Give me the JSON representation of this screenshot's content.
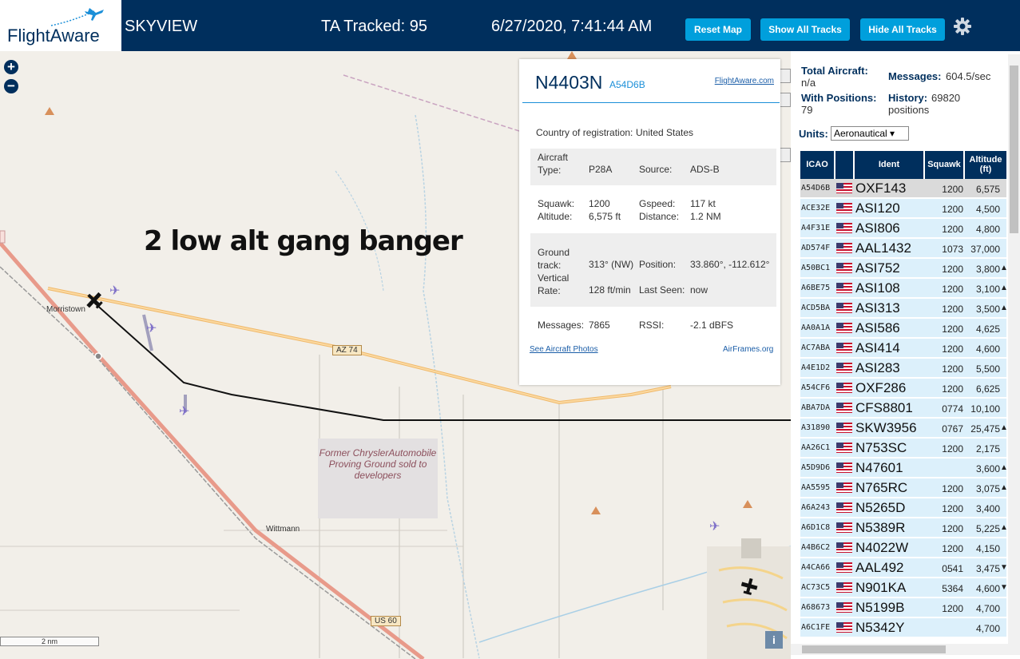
{
  "header": {
    "logo_text": "FlightAware",
    "app_name": "SKYVIEW",
    "tracked": "TA Tracked: 95",
    "datetime": "6/27/2020, 7:41:44 AM",
    "buttons": {
      "reset": "Reset Map",
      "show_all": "Show All Tracks",
      "hide_all": "Hide All Tracks"
    }
  },
  "map": {
    "zoom_in": "+",
    "zoom_out": "−",
    "annotation": "2 low alt gang banger",
    "labels": {
      "morristown": "Morristown",
      "wittmann": "Wittmann",
      "az74": "AZ 74",
      "us60": "US 60"
    },
    "proving_ground": "Former ChryslerAutomobile Proving Ground sold to developers",
    "scale": "2 nm",
    "info": "i"
  },
  "popup": {
    "ident": "N4403N",
    "hex": "A54D6B",
    "fa_link": "FlightAware.com",
    "country_label": "Country of registration:",
    "country": "United States",
    "aircraft_type_label": "Aircraft Type:",
    "aircraft_type": "P28A",
    "source_label": "Source:",
    "source": "ADS-B",
    "squawk_label": "Squawk:",
    "squawk": "1200",
    "gspeed_label": "Gspeed:",
    "gspeed": "117 kt",
    "altitude_label": "Altitude:",
    "altitude": "6,575 ft",
    "distance_label": "Distance:",
    "distance": "1.2 NM",
    "ground_track_label": "Ground track:",
    "ground_track": "313° (NW)",
    "position_label": "Position:",
    "position": "33.860°, -112.612°",
    "vrate_label": "Vertical Rate:",
    "vrate": "128 ft/min",
    "last_seen_label": "Last Seen:",
    "last_seen": "now",
    "messages_label": "Messages:",
    "messages": "7865",
    "rssi_label": "RSSI:",
    "rssi": "-2.1 dBFS",
    "photos_link": "See Aircraft Photos",
    "airframes_link": "AirFrames.org"
  },
  "sidebar": {
    "total_label": "Total Aircraft:",
    "total": "n/a",
    "messages_label": "Messages:",
    "messages": "604.5/sec",
    "with_pos_label": "With Positions:",
    "with_pos": "79",
    "history_label": "History:",
    "history": "69820 positions",
    "units_label": "Units:",
    "units_value": "Aeronautical ▾",
    "columns": {
      "icao": "ICAO",
      "ident": "Ident",
      "squawk": "Squawk",
      "altitude": "Altitude (ft)"
    },
    "rows": [
      {
        "icao": "A54D6B",
        "ident": "OXF143",
        "squawk": "1200",
        "alt": "6,575",
        "trend": ""
      },
      {
        "icao": "ACE32E",
        "ident": "ASI120",
        "squawk": "1200",
        "alt": "4,500",
        "trend": ""
      },
      {
        "icao": "A4F31E",
        "ident": "ASI806",
        "squawk": "1200",
        "alt": "4,800",
        "trend": ""
      },
      {
        "icao": "AD574F",
        "ident": "AAL1432",
        "squawk": "1073",
        "alt": "37,000",
        "trend": ""
      },
      {
        "icao": "A50BC1",
        "ident": "ASI752",
        "squawk": "1200",
        "alt": "3,800",
        "trend": "▲"
      },
      {
        "icao": "A6BE75",
        "ident": "ASI108",
        "squawk": "1200",
        "alt": "3,100",
        "trend": "▲"
      },
      {
        "icao": "ACD5BA",
        "ident": "ASI313",
        "squawk": "1200",
        "alt": "3,500",
        "trend": "▲"
      },
      {
        "icao": "AA0A1A",
        "ident": "ASI586",
        "squawk": "1200",
        "alt": "4,625",
        "trend": ""
      },
      {
        "icao": "AC7ABA",
        "ident": "ASI414",
        "squawk": "1200",
        "alt": "4,600",
        "trend": ""
      },
      {
        "icao": "A4E1D2",
        "ident": "ASI283",
        "squawk": "1200",
        "alt": "5,500",
        "trend": ""
      },
      {
        "icao": "A54CF6",
        "ident": "OXF286",
        "squawk": "1200",
        "alt": "6,625",
        "trend": ""
      },
      {
        "icao": "ABA7DA",
        "ident": "CFS8801",
        "squawk": "0774",
        "alt": "10,100",
        "trend": ""
      },
      {
        "icao": "A31890",
        "ident": "SKW3956",
        "squawk": "0767",
        "alt": "25,475",
        "trend": "▲"
      },
      {
        "icao": "AA26C1",
        "ident": "N753SC",
        "squawk": "1200",
        "alt": "2,175",
        "trend": ""
      },
      {
        "icao": "A5D9D6",
        "ident": "N47601",
        "squawk": "",
        "alt": "3,600",
        "trend": "▲"
      },
      {
        "icao": "AA5595",
        "ident": "N765RC",
        "squawk": "1200",
        "alt": "3,075",
        "trend": "▲"
      },
      {
        "icao": "A6A243",
        "ident": "N5265D",
        "squawk": "1200",
        "alt": "3,400",
        "trend": ""
      },
      {
        "icao": "A6D1C8",
        "ident": "N5389R",
        "squawk": "1200",
        "alt": "5,225",
        "trend": "▲"
      },
      {
        "icao": "A4B6C2",
        "ident": "N4022W",
        "squawk": "1200",
        "alt": "4,150",
        "trend": ""
      },
      {
        "icao": "A4CA66",
        "ident": "AAL492",
        "squawk": "0541",
        "alt": "3,475",
        "trend": "▼"
      },
      {
        "icao": "AC73C5",
        "ident": "N901KA",
        "squawk": "5364",
        "alt": "4,600",
        "trend": "▼"
      },
      {
        "icao": "A68673",
        "ident": "N5199B",
        "squawk": "1200",
        "alt": "4,700",
        "trend": ""
      },
      {
        "icao": "A6C1FE",
        "ident": "N5342Y",
        "squawk": "",
        "alt": "4,700",
        "trend": ""
      }
    ]
  },
  "colors": {
    "brand": "#002f5d",
    "accent": "#009fdc",
    "row_bg": "#dcf0fb"
  }
}
